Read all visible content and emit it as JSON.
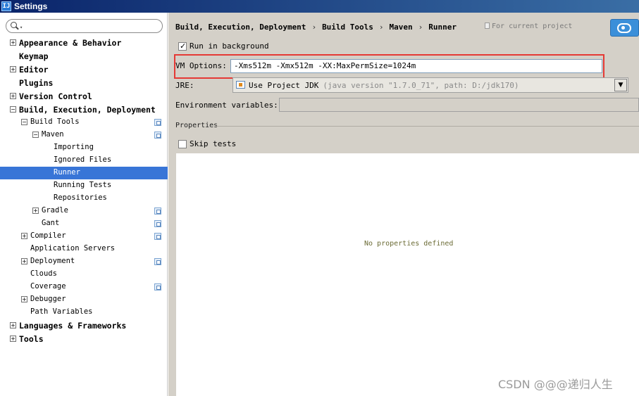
{
  "window": {
    "title": "Settings",
    "icon": "intellij-icon"
  },
  "search": {
    "placeholder": "",
    "value": ""
  },
  "tree": [
    {
      "label": "Appearance & Behavior",
      "level": 0,
      "toggle": "+",
      "bold": true
    },
    {
      "label": "Keymap",
      "level": 0,
      "toggle": "",
      "bold": true
    },
    {
      "label": "Editor",
      "level": 0,
      "toggle": "+",
      "bold": true
    },
    {
      "label": "Plugins",
      "level": 0,
      "toggle": "",
      "bold": true
    },
    {
      "label": "Version Control",
      "level": 0,
      "toggle": "+",
      "bold": true,
      "project": false
    },
    {
      "label": "Build, Execution, Deployment",
      "level": 0,
      "toggle": "-",
      "bold": true
    },
    {
      "label": "Build Tools",
      "level": 1,
      "toggle": "-",
      "project": true
    },
    {
      "label": "Maven",
      "level": 2,
      "toggle": "-",
      "project": true
    },
    {
      "label": "Importing",
      "level": 3,
      "toggle": ""
    },
    {
      "label": "Ignored Files",
      "level": 3,
      "toggle": ""
    },
    {
      "label": "Runner",
      "level": 3,
      "toggle": "",
      "selected": true
    },
    {
      "label": "Running Tests",
      "level": 3,
      "toggle": ""
    },
    {
      "label": "Repositories",
      "level": 3,
      "toggle": ""
    },
    {
      "label": "Gradle",
      "level": 2,
      "toggle": "+",
      "project": true
    },
    {
      "label": "Gant",
      "level": 2,
      "toggle": "",
      "project": true
    },
    {
      "label": "Compiler",
      "level": 1,
      "toggle": "+",
      "project": true
    },
    {
      "label": "Application Servers",
      "level": 1,
      "toggle": ""
    },
    {
      "label": "Deployment",
      "level": 1,
      "toggle": "+",
      "project": true
    },
    {
      "label": "Clouds",
      "level": 1,
      "toggle": ""
    },
    {
      "label": "Coverage",
      "level": 1,
      "toggle": "",
      "project": true
    },
    {
      "label": "Debugger",
      "level": 1,
      "toggle": "+"
    },
    {
      "label": "Path Variables",
      "level": 1,
      "toggle": ""
    },
    {
      "label": "Languages & Frameworks",
      "level": 0,
      "toggle": "+",
      "bold": true
    },
    {
      "label": "Tools",
      "level": 0,
      "toggle": "+",
      "bold": true
    }
  ],
  "breadcrumb": {
    "items": [
      "Build, Execution, Deployment",
      "Build Tools",
      "Maven",
      "Runner"
    ],
    "separator": "›",
    "scope_note": "For current project"
  },
  "runner": {
    "run_in_background": {
      "label": "Run in background",
      "checked": true
    },
    "vm_options": {
      "label": "VM Options:",
      "value": "-Xms512m -Xmx512m -XX:MaxPermSize=1024m"
    },
    "jre": {
      "label": "JRE:",
      "value": "Use Project JDK",
      "hint": "(java version \"1.7.0_71\", path: D:/jdk170)"
    },
    "env_vars": {
      "label": "Environment variables:",
      "value": ""
    },
    "properties": {
      "section_title": "Properties",
      "skip_tests": {
        "label": "Skip tests",
        "checked": false
      },
      "empty_text": "No properties defined"
    }
  },
  "watermark": "CSDN @@@递归人生",
  "colors": {
    "selection": "#3875d7",
    "panel": "#d4d0c8",
    "highlight": "#e53935",
    "help_button": "#3b8fd9"
  }
}
